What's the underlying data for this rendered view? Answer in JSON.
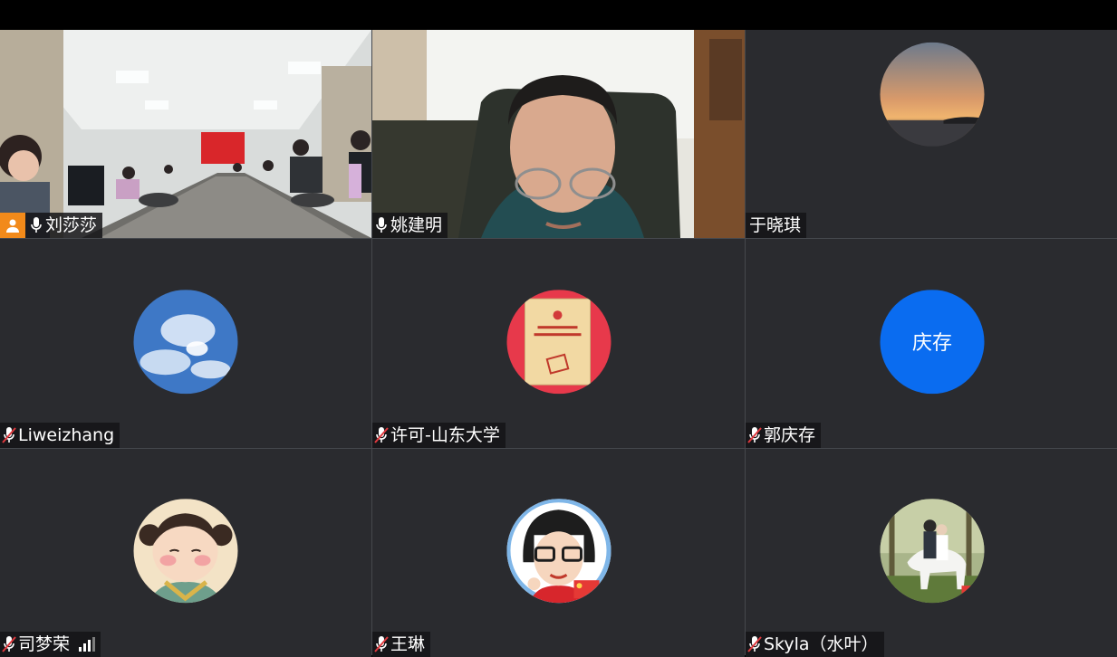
{
  "participants": [
    {
      "name": "刘莎莎",
      "mic": "on",
      "host": true,
      "video": "conference-room"
    },
    {
      "name": "姚建明",
      "mic": "on",
      "host": false,
      "video": "webcam-man"
    },
    {
      "name": "于晓琪",
      "mic": "none",
      "host": false,
      "avatar": "sunset-photo"
    },
    {
      "name": "Liweizhang",
      "mic": "muted",
      "host": false,
      "avatar": "sky-clouds-photo"
    },
    {
      "name": "许可-山东大学",
      "mic": "muted",
      "host": false,
      "avatar": "red-book-photo"
    },
    {
      "name": "郭庆存",
      "mic": "muted",
      "host": false,
      "avatar_text": "庆存",
      "avatar_color": "#0a6cf0"
    },
    {
      "name": "司梦荣",
      "mic": "muted",
      "host": false,
      "avatar": "cartoon-girl",
      "signal": true
    },
    {
      "name": "王琳",
      "mic": "muted",
      "host": false,
      "avatar": "cartoon-glasses"
    },
    {
      "name": "Skyla（水叶）",
      "mic": "muted",
      "host": false,
      "avatar": "couple-horse-photo"
    }
  ],
  "colors": {
    "tile_bg": "#2a2b2f",
    "host_badge": "#f28a1a",
    "muted_slash": "#e0393e"
  }
}
